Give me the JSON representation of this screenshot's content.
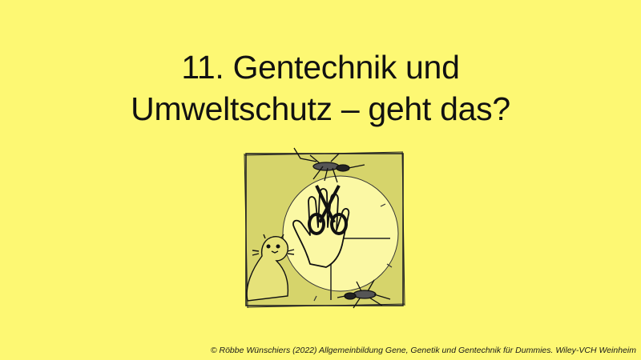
{
  "slide": {
    "title_line1": "11. Gentechnik und",
    "title_line2": "Umweltschutz – geht das?",
    "caption": "© Röbbe Wünschiers (2022) Allgemeinbildung Gene, Genetik und Gentechnik für Dummies. Wiley-VCH Weinheim"
  },
  "colors": {
    "background": "#fdf873",
    "frame_fill": "#d4d26a",
    "circle": "#fcfaa6",
    "ink": "#111111"
  },
  "icons": {
    "illustration": "hand-with-scissors-mosquito-otter-icon"
  }
}
